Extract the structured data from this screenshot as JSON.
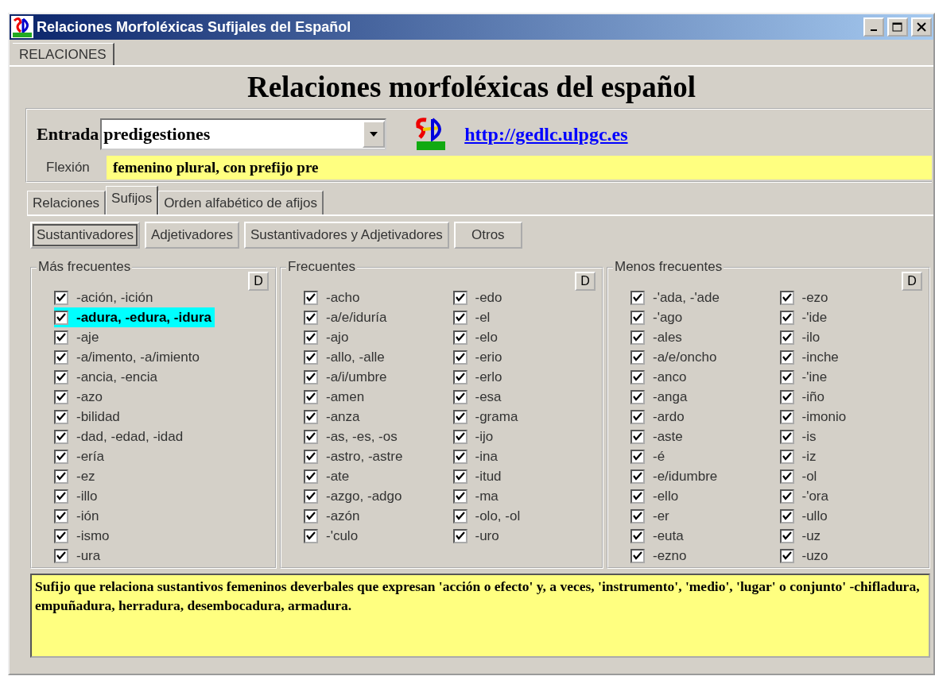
{
  "window": {
    "title": "Relaciones Morfoléxicas Sufijales del Español"
  },
  "top_tabs": [
    {
      "label": "RELACIONES",
      "selected": true
    }
  ],
  "heading": "Relaciones morfoléxicas del español",
  "entrada": {
    "label": "Entrada",
    "value": "predigestiones"
  },
  "link": "http://gedlc.ulpgc.es",
  "flexion": {
    "label": "Flexión",
    "value": "femenino plural, con prefijo pre"
  },
  "tabs": [
    {
      "label": "Relaciones",
      "selected": false
    },
    {
      "label": "Sufijos",
      "selected": true
    },
    {
      "label": "Orden alfabético de afijos",
      "selected": false
    }
  ],
  "category_buttons": [
    {
      "label": "Sustantivadores",
      "selected": true
    },
    {
      "label": "Adjetivadores",
      "selected": false
    },
    {
      "label": "Sustantivadores y Adjetivadores",
      "selected": false
    },
    {
      "label": "Otros",
      "selected": false
    }
  ],
  "groups": [
    {
      "title": "Más frecuentes",
      "button": "D",
      "columns": [
        [
          {
            "label": "-ación, -ición",
            "checked": true,
            "selected": false
          },
          {
            "label": "-adura, -edura, -idura",
            "checked": true,
            "selected": true
          },
          {
            "label": "-aje",
            "checked": true,
            "selected": false
          },
          {
            "label": "-a/imento, -a/imiento",
            "checked": true,
            "selected": false
          },
          {
            "label": "-ancia, -encia",
            "checked": true,
            "selected": false
          },
          {
            "label": "-azo",
            "checked": true,
            "selected": false
          },
          {
            "label": "-bilidad",
            "checked": true,
            "selected": false
          },
          {
            "label": "-dad, -edad, -idad",
            "checked": true,
            "selected": false
          },
          {
            "label": "-ería",
            "checked": true,
            "selected": false
          },
          {
            "label": "-ez",
            "checked": true,
            "selected": false
          },
          {
            "label": "-illo",
            "checked": true,
            "selected": false
          },
          {
            "label": "-ión",
            "checked": true,
            "selected": false
          },
          {
            "label": "-ismo",
            "checked": true,
            "selected": false
          },
          {
            "label": "-ura",
            "checked": true,
            "selected": false
          }
        ]
      ]
    },
    {
      "title": "Frecuentes",
      "button": "D",
      "columns": [
        [
          {
            "label": "-acho",
            "checked": true,
            "selected": false
          },
          {
            "label": "-a/e/iduría",
            "checked": true,
            "selected": false
          },
          {
            "label": "-ajo",
            "checked": true,
            "selected": false
          },
          {
            "label": "-allo,  -alle",
            "checked": true,
            "selected": false
          },
          {
            "label": "-a/i/umbre",
            "checked": true,
            "selected": false
          },
          {
            "label": "-amen",
            "checked": true,
            "selected": false
          },
          {
            "label": "-anza",
            "checked": true,
            "selected": false
          },
          {
            "label": "-as, -es, -os",
            "checked": true,
            "selected": false
          },
          {
            "label": "-astro, -astre",
            "checked": true,
            "selected": false
          },
          {
            "label": "-ate",
            "checked": true,
            "selected": false
          },
          {
            "label": "-azgo, -adgo",
            "checked": true,
            "selected": false
          },
          {
            "label": "-azón",
            "checked": true,
            "selected": false
          },
          {
            "label": "-'culo",
            "checked": true,
            "selected": false
          }
        ],
        [
          {
            "label": "-edo",
            "checked": true,
            "selected": false
          },
          {
            "label": "-el",
            "checked": true,
            "selected": false
          },
          {
            "label": "-elo",
            "checked": true,
            "selected": false
          },
          {
            "label": "-erio",
            "checked": true,
            "selected": false
          },
          {
            "label": "-erlo",
            "checked": true,
            "selected": false
          },
          {
            "label": "-esa",
            "checked": true,
            "selected": false
          },
          {
            "label": "-grama",
            "checked": true,
            "selected": false
          },
          {
            "label": "-ijo",
            "checked": true,
            "selected": false
          },
          {
            "label": "-ina",
            "checked": true,
            "selected": false
          },
          {
            "label": "-itud",
            "checked": true,
            "selected": false
          },
          {
            "label": "-ma",
            "checked": true,
            "selected": false
          },
          {
            "label": "-olo, -ol",
            "checked": true,
            "selected": false
          },
          {
            "label": "-uro",
            "checked": true,
            "selected": false
          }
        ]
      ]
    },
    {
      "title": "Menos frecuentes",
      "button": "D",
      "columns": [
        [
          {
            "label": "-'ada, -'ade",
            "checked": true,
            "selected": false
          },
          {
            "label": "-'ago",
            "checked": true,
            "selected": false
          },
          {
            "label": "-ales",
            "checked": true,
            "selected": false
          },
          {
            "label": "-a/e/oncho",
            "checked": true,
            "selected": false
          },
          {
            "label": "-anco",
            "checked": true,
            "selected": false
          },
          {
            "label": "-anga",
            "checked": true,
            "selected": false
          },
          {
            "label": "-ardo",
            "checked": true,
            "selected": false
          },
          {
            "label": "-aste",
            "checked": true,
            "selected": false
          },
          {
            "label": "-é",
            "checked": true,
            "selected": false
          },
          {
            "label": "-e/idumbre",
            "checked": true,
            "selected": false
          },
          {
            "label": "-ello",
            "checked": true,
            "selected": false
          },
          {
            "label": "-er",
            "checked": true,
            "selected": false
          },
          {
            "label": "-euta",
            "checked": true,
            "selected": false
          },
          {
            "label": "-ezno",
            "checked": true,
            "selected": false
          }
        ],
        [
          {
            "label": "-ezo",
            "checked": true,
            "selected": false
          },
          {
            "label": "-'ide",
            "checked": true,
            "selected": false
          },
          {
            "label": "-ilo",
            "checked": true,
            "selected": false
          },
          {
            "label": "-inche",
            "checked": true,
            "selected": false
          },
          {
            "label": "-'ine",
            "checked": true,
            "selected": false
          },
          {
            "label": "-iño",
            "checked": true,
            "selected": false
          },
          {
            "label": "-imonio",
            "checked": true,
            "selected": false
          },
          {
            "label": "-is",
            "checked": true,
            "selected": false
          },
          {
            "label": "-iz",
            "checked": true,
            "selected": false
          },
          {
            "label": "-ol",
            "checked": true,
            "selected": false
          },
          {
            "label": "-'ora",
            "checked": true,
            "selected": false
          },
          {
            "label": "-ullo",
            "checked": true,
            "selected": false
          },
          {
            "label": "-uz",
            "checked": true,
            "selected": false
          },
          {
            "label": "-uzo",
            "checked": true,
            "selected": false
          }
        ]
      ]
    }
  ],
  "description": "Sufijo que relaciona sustantivos femeninos deverbales que expresan 'acción o efecto' y, a veces, 'instrumento', 'medio', 'lugar' o conjunto' -chifladura, empuñadura, herradura, desembocadura, armadura."
}
